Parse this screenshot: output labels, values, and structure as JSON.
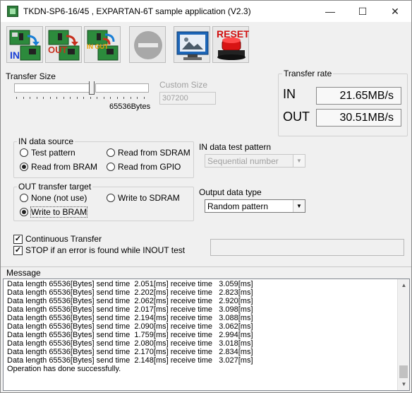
{
  "window": {
    "title": "TKDN-SP6-16/45 , EXPARTAN-6T sample application (V2.3)",
    "minimize_glyph": "—",
    "maximize_glyph": "☐",
    "close_glyph": "✕"
  },
  "toolbar": {
    "buttons": [
      {
        "name": "in-transfer",
        "text": "IN"
      },
      {
        "name": "out-transfer",
        "text": "OUT"
      },
      {
        "name": "inout-transfer",
        "text": "IN OUT"
      },
      {
        "name": "stop",
        "text": ""
      },
      {
        "name": "view",
        "text": ""
      },
      {
        "name": "reset",
        "text": "RESET"
      }
    ]
  },
  "transfer_size": {
    "label": "Transfer Size",
    "bytes_label": "65536Bytes",
    "custom_label": "Custom Size",
    "custom_value": "307200"
  },
  "transfer_rate": {
    "title": "Transfer rate",
    "in_label": "IN",
    "in_value": "21.65MB/s",
    "out_label": "OUT",
    "out_value": "30.51MB/s"
  },
  "in_source": {
    "title": "IN data source",
    "options": [
      "Test pattern",
      "Read from SDRAM",
      "Read from BRAM",
      "Read from GPIO"
    ],
    "selected": "Read from BRAM"
  },
  "in_pattern": {
    "title": "IN data test pattern",
    "value": "Sequential number"
  },
  "out_target": {
    "title": "OUT transfer target",
    "options": [
      "None (not use)",
      "Write to SDRAM",
      "Write to BRAM"
    ],
    "selected": "Write to BRAM"
  },
  "out_type": {
    "title": "Output data type",
    "value": "Random pattern"
  },
  "options": {
    "continuous": "Continuous Transfer",
    "stop_on_error": "STOP if an error is found while INOUT test"
  },
  "message": {
    "title": "Message",
    "lines": [
      "Data length 65536[Bytes] send time  2.051[ms] receive time   3.059[ms]",
      "Data length 65536[Bytes] send time  2.202[ms] receive time   2.823[ms]",
      "Data length 65536[Bytes] send time  2.062[ms] receive time   2.920[ms]",
      "Data length 65536[Bytes] send time  2.017[ms] receive time   3.098[ms]",
      "Data length 65536[Bytes] send time  2.194[ms] receive time   3.088[ms]",
      "Data length 65536[Bytes] send time  2.090[ms] receive time   3.062[ms]",
      "Data length 65536[Bytes] send time  1.759[ms] receive time   2.994[ms]",
      "Data length 65536[Bytes] send time  2.080[ms] receive time   3.018[ms]",
      "Data length 65536[Bytes] send time  2.170[ms] receive time   2.834[ms]",
      "Data length 65536[Bytes] send time  2.148[ms] receive time   3.027[ms]",
      "Operation has done successfully."
    ]
  }
}
